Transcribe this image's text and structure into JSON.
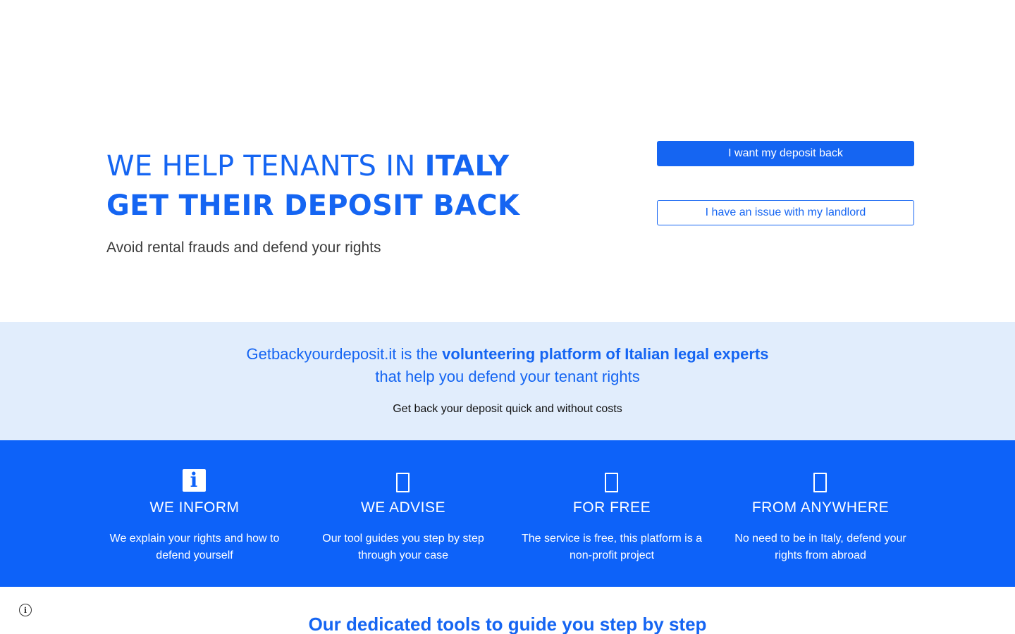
{
  "hero": {
    "title_line1_regular": "WE HELP TENANTS IN ",
    "title_line1_bold": "ITALY",
    "title_line2_bold": "GET THEIR DEPOSIT BACK",
    "subtitle": "Avoid rental frauds and defend your rights",
    "primary_button": "I want my deposit back",
    "secondary_button": "I have an issue with my landlord"
  },
  "intro": {
    "text_part1": "Getbackyourdeposit.it is the ",
    "text_bold": "volunteering platform of Italian legal experts",
    "text_part2": " that help you defend your tenant rights",
    "subtext": "Get back your deposit quick and without costs"
  },
  "features": [
    {
      "icon": "info-icon",
      "icon_glyph": "i",
      "title": "WE INFORM",
      "description": "We explain your rights and how to defend yourself"
    },
    {
      "icon": "advise-icon",
      "title": "WE ADVISE",
      "description": "Our tool guides you step by step through your case"
    },
    {
      "icon": "free-icon",
      "title": "FOR FREE",
      "description": "The service is free, this platform is a non-profit project"
    },
    {
      "icon": "globe-icon",
      "title": "FROM ANYWHERE",
      "description": "No need to be in Italy, defend your rights from abroad"
    }
  ],
  "tools": {
    "heading": "Our dedicated tools to guide you step by step"
  },
  "site_info": {
    "icon": "site-info-icon",
    "glyph": "i"
  },
  "colors": {
    "brand_blue": "#1565f2",
    "features_bg": "#0d62f9",
    "intro_bg": "#e1edfc",
    "subtitle_gray": "#3b3b3b"
  }
}
